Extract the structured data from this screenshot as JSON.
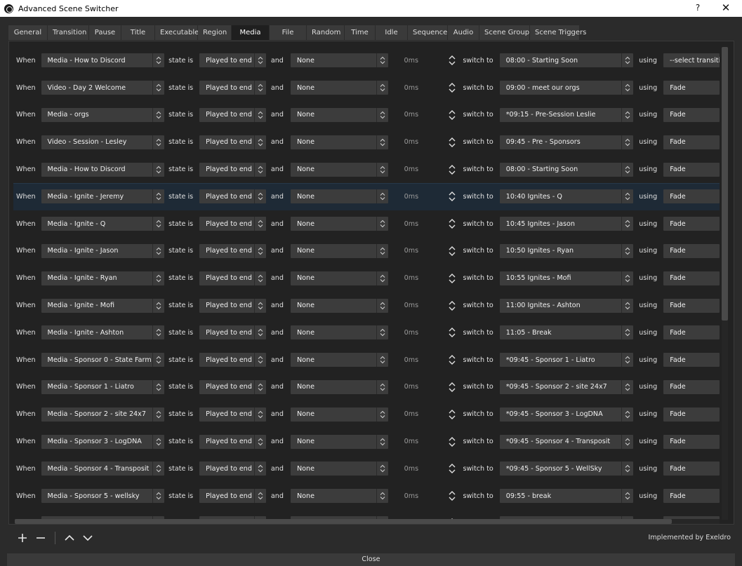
{
  "window": {
    "title": "Advanced Scene Switcher",
    "help": "?",
    "close": "✕"
  },
  "tabs": [
    "General",
    "Transition",
    "Pause",
    "Title",
    "Executable",
    "Region",
    "Media",
    "File",
    "Random",
    "Time",
    "Idle",
    "Sequence",
    "Audio",
    "Scene Group",
    "Scene Triggers"
  ],
  "active_tab": "Media",
  "labels": {
    "when": "When",
    "state_is": "state is",
    "and": "and",
    "switch_to": "switch to",
    "using": "using"
  },
  "rows": [
    {
      "media": "Media - How to Discord",
      "state": "Played to end",
      "time_restriction": "None",
      "ms": "0ms",
      "scene": "08:00 - Starting Soon",
      "transition": "--select transition--"
    },
    {
      "media": "Video - Day 2 Welcome",
      "state": "Played to end",
      "time_restriction": "None",
      "ms": "0ms",
      "scene": "09:00 - meet our orgs",
      "transition": "Fade"
    },
    {
      "media": "Media - orgs",
      "state": "Played to end",
      "time_restriction": "None",
      "ms": "0ms",
      "scene": "*09:15 - Pre-Session Leslie",
      "transition": "Fade"
    },
    {
      "media": "Video - Session - Lesley",
      "state": "Played to end",
      "time_restriction": "None",
      "ms": "0ms",
      "scene": "09:45 - Pre - Sponsors",
      "transition": "Fade"
    },
    {
      "media": "Media - How to Discord",
      "state": "Played to end",
      "time_restriction": "None",
      "ms": "0ms",
      "scene": "08:00 - Starting Soon",
      "transition": "Fade"
    },
    {
      "media": "Media - Ignite - Jeremy",
      "state": "Played to end",
      "time_restriction": "None",
      "ms": "0ms",
      "scene": "10:40 Ignites - Q",
      "transition": "Fade",
      "selected": true
    },
    {
      "media": "Media - Ignite - Q",
      "state": "Played to end",
      "time_restriction": "None",
      "ms": "0ms",
      "scene": "10:45 Ignites - Jason",
      "transition": "Fade"
    },
    {
      "media": "Media - Ignite - Jason",
      "state": "Played to end",
      "time_restriction": "None",
      "ms": "0ms",
      "scene": "10:50 Ignites - Ryan",
      "transition": "Fade"
    },
    {
      "media": "Media - Ignite - Ryan",
      "state": "Played to end",
      "time_restriction": "None",
      "ms": "0ms",
      "scene": "10:55 Ignites - Mofi",
      "transition": "Fade"
    },
    {
      "media": "Media - Ignite - Mofi",
      "state": "Played to end",
      "time_restriction": "None",
      "ms": "0ms",
      "scene": "11:00 Ignites - Ashton",
      "transition": "Fade"
    },
    {
      "media": "Media - Ignite - Ashton",
      "state": "Played to end",
      "time_restriction": "None",
      "ms": "0ms",
      "scene": "11:05 - Break",
      "transition": "Fade"
    },
    {
      "media": "Media - Sponsor 0 - State Farm",
      "state": "Played to end",
      "time_restriction": "None",
      "ms": "0ms",
      "scene": "*09:45 - Sponsor 1 - Liatro",
      "transition": "Fade"
    },
    {
      "media": "Media - Sponsor 1 - Liatro",
      "state": "Played to end",
      "time_restriction": "None",
      "ms": "0ms",
      "scene": "*09:45 - Sponsor 2 - site 24x7",
      "transition": "Fade"
    },
    {
      "media": "Media - Sponsor 2 - site 24x7",
      "state": "Played to end",
      "time_restriction": "None",
      "ms": "0ms",
      "scene": "*09:45 - Sponsor 3 - LogDNA",
      "transition": "Fade"
    },
    {
      "media": "Media - Sponsor 3 - LogDNA",
      "state": "Played to end",
      "time_restriction": "None",
      "ms": "0ms",
      "scene": "*09:45 - Sponsor 4 - Transposit",
      "transition": "Fade"
    },
    {
      "media": "Media - Sponsor 4 - Transposit",
      "state": "Played to end",
      "time_restriction": "None",
      "ms": "0ms",
      "scene": "*09:45 - Sponsor 5 - WellSky",
      "transition": "Fade"
    },
    {
      "media": "Media - Sponsor 5 - wellsky",
      "state": "Played to end",
      "time_restriction": "None",
      "ms": "0ms",
      "scene": "09:55 - break",
      "transition": "Fade"
    },
    {
      "media": "",
      "state": "",
      "time_restriction": "",
      "ms": "",
      "scene": "",
      "transition": ""
    }
  ],
  "footer": {
    "credit": "Implemented by Exeldro",
    "close_label": "Close"
  },
  "colors": {
    "background": "#2b2b2b",
    "panel": "#222222",
    "combo": "#3c3c3c",
    "selected_row": "#1e2a36",
    "active_tab": "#1f1f1f"
  }
}
